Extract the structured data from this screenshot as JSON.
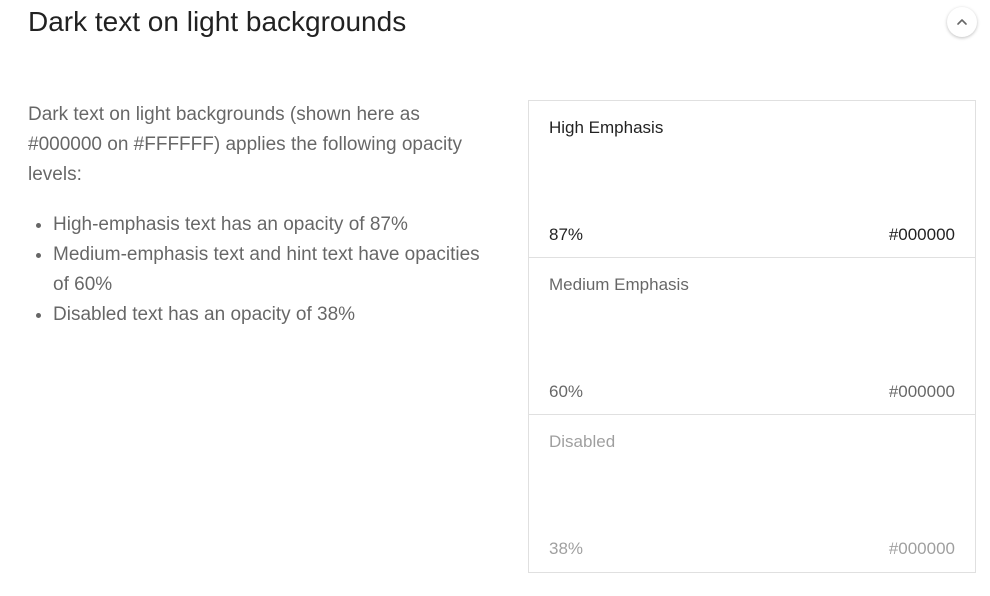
{
  "section": {
    "title": "Dark text on light backgrounds",
    "collapse_icon": "chevron-up-icon"
  },
  "intro": {
    "text": "Dark text on light backgrounds (shown here as #000000 on #FFFFFF) applies the following opacity levels:"
  },
  "bullets": [
    "High-emphasis text has an opacity of 87%",
    "Medium-emphasis text and hint text have opacities of 60%",
    "Disabled text has an opacity of 38%"
  ],
  "swatches": [
    {
      "name": "High Emphasis",
      "opacity_label": "87%",
      "hex": "#000000",
      "opacity": 0.87
    },
    {
      "name": "Medium Emphasis",
      "opacity_label": "60%",
      "hex": "#000000",
      "opacity": 0.6
    },
    {
      "name": "Disabled",
      "opacity_label": "38%",
      "hex": "#000000",
      "opacity": 0.38
    }
  ],
  "colors": {
    "text": "#000000",
    "background": "#FFFFFF",
    "divider": "#E0E0E0"
  }
}
